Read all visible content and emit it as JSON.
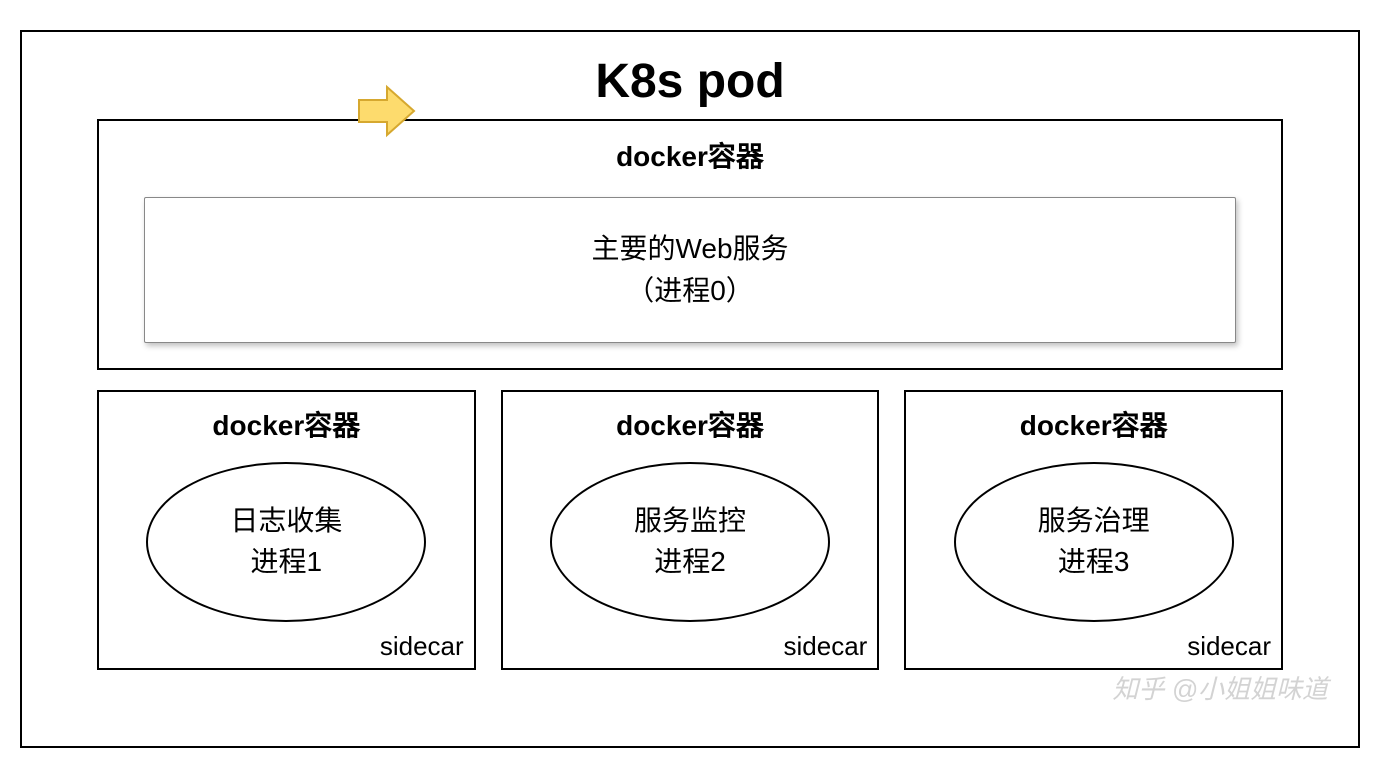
{
  "pod": {
    "title": "K8s pod",
    "main_container": {
      "title": "docker容器",
      "service_line1": "主要的Web服务",
      "service_line2": "（进程0）"
    },
    "sidecars": [
      {
        "title": "docker容器",
        "line1": "日志收集",
        "line2": "进程1",
        "label": "sidecar"
      },
      {
        "title": "docker容器",
        "line1": "服务监控",
        "line2": "进程2",
        "label": "sidecar"
      },
      {
        "title": "docker容器",
        "line1": "服务治理",
        "line2": "进程3",
        "label": "sidecar"
      }
    ]
  },
  "watermark": "知乎 @小姐姐味道"
}
